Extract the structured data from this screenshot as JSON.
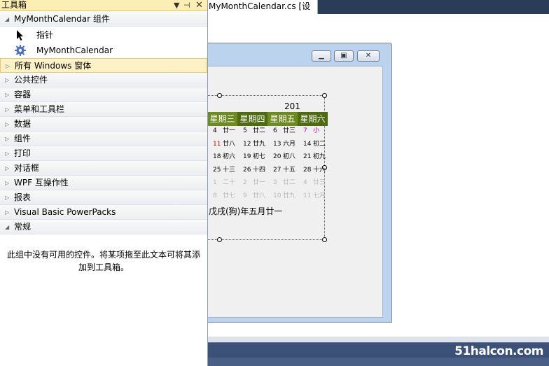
{
  "toolbox": {
    "title": "工具箱",
    "groups": [
      {
        "label": "MyMonthCalendar 组件",
        "expanded": true
      },
      {
        "label": "所有 Windows 窗体"
      },
      {
        "label": "公共控件"
      },
      {
        "label": "容器"
      },
      {
        "label": "菜单和工具栏"
      },
      {
        "label": "数据"
      },
      {
        "label": "组件"
      },
      {
        "label": "打印"
      },
      {
        "label": "对话框"
      },
      {
        "label": "WPF 互操作性"
      },
      {
        "label": "报表"
      },
      {
        "label": "Visual Basic PowerPacks"
      },
      {
        "label": "常规",
        "expanded": true
      }
    ],
    "items": [
      {
        "label": "指针",
        "icon": "pointer-icon"
      },
      {
        "label": "MyMonthCalendar",
        "icon": "gear-icon"
      }
    ],
    "empty_message": "此组中没有可用的控件。将某项拖至此文本可将其添加到工具箱。"
  },
  "document": {
    "tab_title": "MyMonthCalendar.cs [设计]"
  },
  "calendar": {
    "year_partial": "201",
    "weekdays": [
      "星期三",
      "星期四",
      "星期五",
      "星期六"
    ],
    "rows": [
      [
        {
          "d": "4",
          "l": "廿一",
          "state": "selected"
        },
        {
          "d": "5",
          "l": "廿二"
        },
        {
          "d": "6",
          "l": "廿三"
        },
        {
          "d": "7",
          "l": "小",
          "state": "magenta"
        }
      ],
      [
        {
          "d": "11",
          "l": "廿八",
          "state": "red"
        },
        {
          "d": "12",
          "l": "廿九"
        },
        {
          "d": "13",
          "l": "六月"
        },
        {
          "d": "14",
          "l": "初二"
        }
      ],
      [
        {
          "d": "18",
          "l": "初六"
        },
        {
          "d": "19",
          "l": "初七"
        },
        {
          "d": "20",
          "l": "初八"
        },
        {
          "d": "21",
          "l": "初九"
        }
      ],
      [
        {
          "d": "25",
          "l": "十三"
        },
        {
          "d": "26",
          "l": "十四"
        },
        {
          "d": "27",
          "l": "十五"
        },
        {
          "d": "28",
          "l": "十六"
        }
      ],
      [
        {
          "d": "1",
          "l": "二十",
          "state": "dim"
        },
        {
          "d": "2",
          "l": "廿一",
          "state": "dim"
        },
        {
          "d": "3",
          "l": "廿二",
          "state": "dim"
        },
        {
          "d": "4",
          "l": "廿三",
          "state": "dim"
        }
      ],
      [
        {
          "d": "8",
          "l": "廿七",
          "state": "dim"
        },
        {
          "d": "9",
          "l": "廿八",
          "state": "dim"
        },
        {
          "d": "10",
          "l": "廿九",
          "state": "dim"
        },
        {
          "d": "11",
          "l": "七月",
          "state": "dim"
        }
      ]
    ],
    "lunar_text": "戊戌(狗)年五月廿一"
  },
  "watermark": "51halcon.com",
  "colors": {
    "calendar_header": "#6e8b1f",
    "selection": "#3a62c4",
    "toolbox_hover": "#fdf1c6"
  }
}
